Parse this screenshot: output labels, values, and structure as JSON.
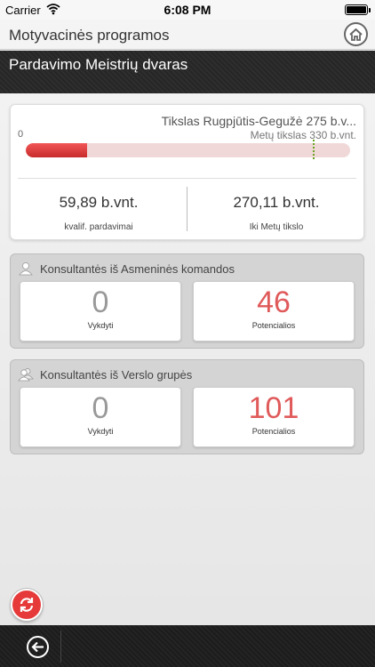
{
  "status_bar": {
    "carrier": "Carrier",
    "time": "6:08 PM"
  },
  "nav": {
    "title": "Motyvacinės programos",
    "home_icon": "home-icon"
  },
  "program": {
    "name": "Pardavimo Meistrių dvaras"
  },
  "progress_card": {
    "goal_text": "Tikslas Rugpjūtis-Gegužė 275 b.v...",
    "zero_label": "0",
    "year_goal_text": "Metų tikslas 330 b.vnt.",
    "progress_fraction": 0.19,
    "year_goal_marker_fraction": 0.885,
    "colors": {
      "fill": "#e03a3a",
      "track": "#f0d8d8",
      "marker": "#6aa520"
    },
    "left_stat": {
      "value": "59,89 b.vnt.",
      "label": "kvalif. pardavimai"
    },
    "right_stat": {
      "value": "270,11 b.vnt.",
      "label": "Iki Metų tikslo"
    }
  },
  "personal_team": {
    "title": "Konsultantės iš Asmeninės komandos",
    "icon": "person-icon",
    "active": {
      "value": "0",
      "label": "Vykdyti"
    },
    "potential": {
      "value": "46",
      "label": "Potencialios"
    }
  },
  "business_group": {
    "title": "Konsultantės iš Verslo grupės",
    "icon": "group-icon",
    "active": {
      "value": "0",
      "label": "Vykdyti"
    },
    "potential": {
      "value": "101",
      "label": "Potencialios"
    }
  },
  "actions": {
    "refresh_icon": "refresh-icon",
    "back_icon": "back-arrow-icon"
  }
}
